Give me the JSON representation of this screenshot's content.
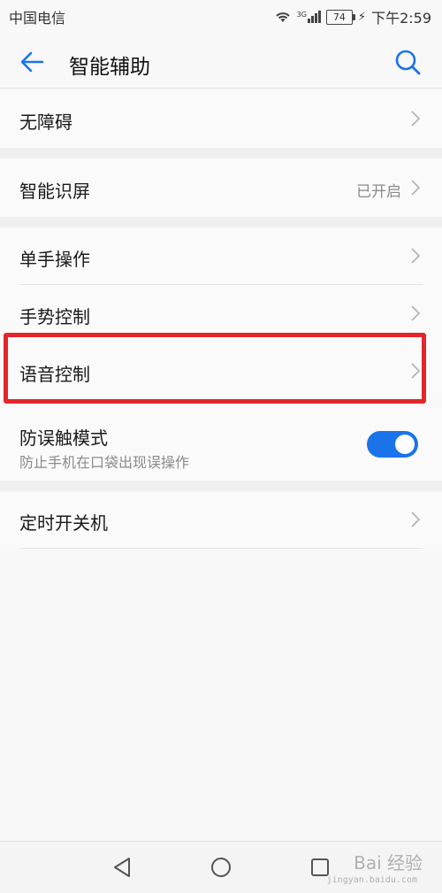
{
  "status_bar": {
    "carrier": "中国电信",
    "network": "3G",
    "battery": "74",
    "time": "下午2:59"
  },
  "header": {
    "title": "智能辅助",
    "back_icon": "arrow-left-icon",
    "search_icon": "search-icon"
  },
  "settings": {
    "accessibility": {
      "label": "无障碍"
    },
    "smart_screen": {
      "label": "智能识屏",
      "value": "已开启"
    },
    "one_hand": {
      "label": "单手操作"
    },
    "gesture": {
      "label": "手势控制"
    },
    "voice": {
      "label": "语音控制"
    },
    "pocket_mode": {
      "label": "防误触模式",
      "description": "防止手机在口袋出现误操作",
      "enabled": true
    },
    "scheduled_power": {
      "label": "定时开关机"
    }
  },
  "colors": {
    "accent": "#1a73e8",
    "highlight": "#e3262b"
  },
  "watermark": {
    "brand": "Bai 经验",
    "url": "jingyan.baidu.com"
  }
}
